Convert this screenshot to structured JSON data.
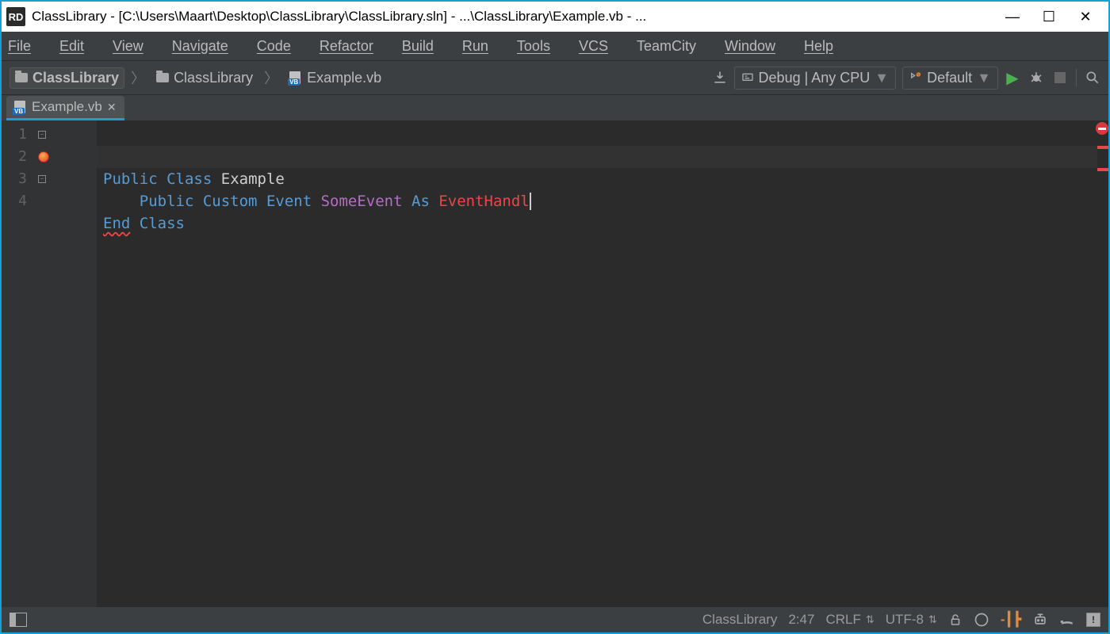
{
  "title": "ClassLibrary - [C:\\Users\\Maart\\Desktop\\ClassLibrary\\ClassLibrary.sln] - ...\\ClassLibrary\\Example.vb - ...",
  "app_badge": "RD",
  "menu": [
    "File",
    "Edit",
    "View",
    "Navigate",
    "Code",
    "Refactor",
    "Build",
    "Run",
    "Tools",
    "VCS",
    "TeamCity",
    "Window",
    "Help"
  ],
  "breadcrumbs": {
    "root": "ClassLibrary",
    "project": "ClassLibrary",
    "file": "Example.vb"
  },
  "configuration": "Debug | Any CPU",
  "run_profile": "Default",
  "tab": {
    "label": "Example.vb"
  },
  "code": {
    "lines": [
      "1",
      "2",
      "3",
      "4"
    ],
    "l1": {
      "t1": "Public",
      "t2": "Class",
      "t3": "Example"
    },
    "l2": {
      "t1": "Public",
      "t2": "Custom",
      "t3": "Event",
      "t4": "SomeEvent",
      "t5": "As",
      "t6": "EventHandl"
    },
    "l3": {
      "t1": "End",
      "t2": "Class"
    }
  },
  "status": {
    "context": "ClassLibrary",
    "linecol": "2:47",
    "eol": "CRLF",
    "encoding": "UTF-8",
    "excl": "!"
  }
}
